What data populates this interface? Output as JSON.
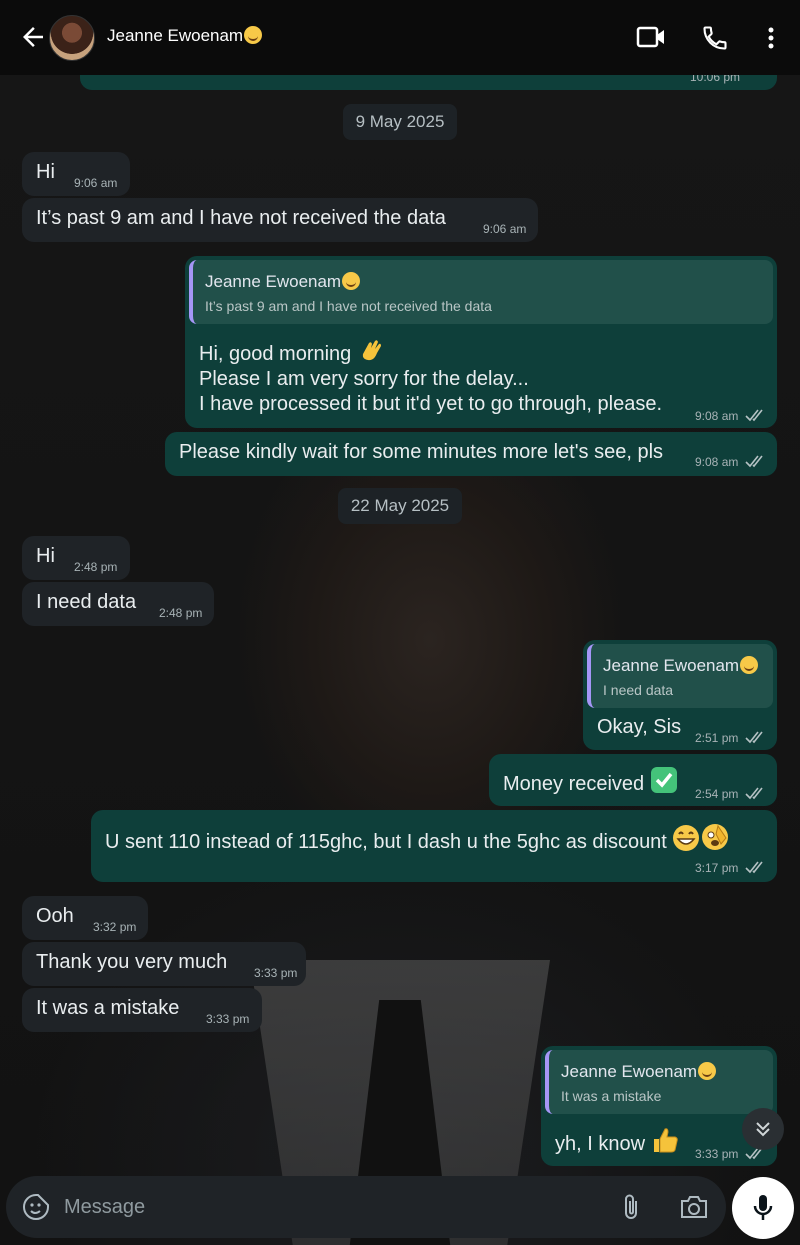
{
  "header": {
    "back_icon": "arrow-left-icon",
    "contact_name": "Jeanne Ewoenam",
    "video_icon": "video-call-icon",
    "call_icon": "phone-icon",
    "menu_icon": "more-vert-icon"
  },
  "chat": {
    "top_partial_time": "10:06 pm",
    "date_1": "9 May 2025",
    "date_2": "22 May 2025",
    "messages": [
      {
        "text": "Hi",
        "time": "9:06 am"
      },
      {
        "text": "It’s past 9 am and I have not received the data",
        "time": "9:06 am"
      },
      {
        "quote_name": "Jeanne Ewoenam",
        "quote_text": "It’s past 9 am and I have not received the data",
        "line1": "Hi, good morning",
        "line2": "Please I am very sorry for the delay...",
        "line3": "I have processed it but it'd yet to go through, please.",
        "time": "9:08 am"
      },
      {
        "text": "Please kindly wait for some minutes more let's see, pls",
        "time": "9:08 am"
      },
      {
        "text": "Hi",
        "time": "2:48 pm"
      },
      {
        "text": "I need data",
        "time": "2:48 pm"
      },
      {
        "quote_name": "Jeanne Ewoenam",
        "quote_text": "I need data",
        "text": "Okay, Sis",
        "time": "2:51 pm"
      },
      {
        "text": "Money received",
        "time": "2:54 pm"
      },
      {
        "text": "U sent 110 instead of 115ghc, but I dash u the 5ghc as discount",
        "time": "3:17 pm"
      },
      {
        "text": "Ooh",
        "time": "3:32 pm"
      },
      {
        "text": "Thank you very much",
        "time": "3:33 pm"
      },
      {
        "text": "It was a mistake",
        "time": "3:33 pm"
      },
      {
        "quote_name": "Jeanne Ewoenam",
        "quote_text": "It was a mistake",
        "text": "yh, I know",
        "time": "3:33 pm"
      }
    ]
  },
  "composer": {
    "placeholder": "Message",
    "sticker_icon": "sticker-icon",
    "attach_icon": "paperclip-icon",
    "camera_icon": "camera-icon",
    "mic_icon": "microphone-icon"
  },
  "colors": {
    "incoming_bubble": "#1f2327",
    "outgoing_bubble": "#0e3f3a",
    "quote_accent": "#a596f6"
  }
}
